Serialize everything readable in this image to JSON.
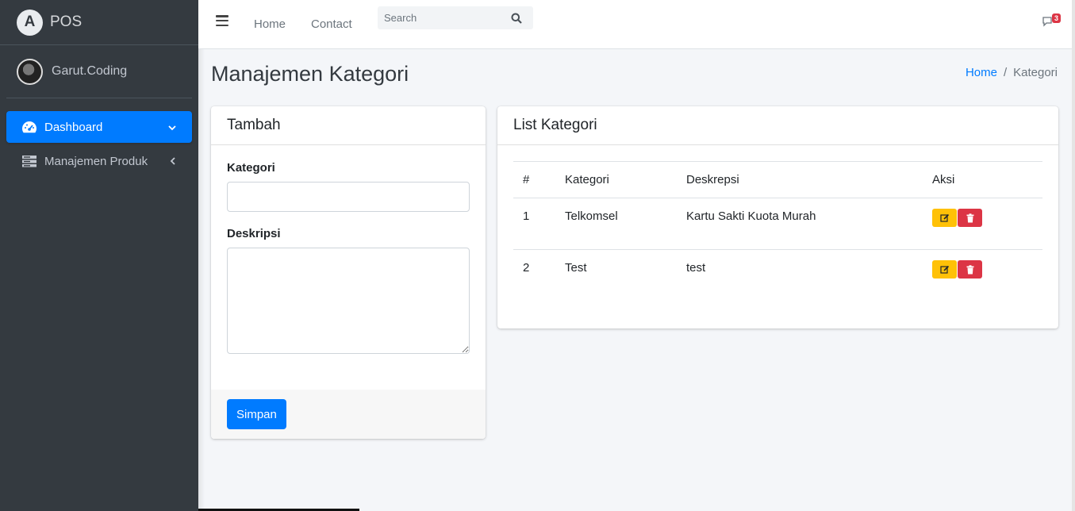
{
  "brand": {
    "name": "POS",
    "logo_letter": "A"
  },
  "user": {
    "name": "Garut.Coding"
  },
  "sidebar": {
    "items": [
      {
        "label": "Dashboard",
        "icon": "gauge-icon",
        "caret": "chevron-down-icon",
        "active": true
      },
      {
        "label": "Manajemen Produk",
        "icon": "server-icon",
        "caret": "chevron-left-icon",
        "active": false
      }
    ]
  },
  "navbar": {
    "links": [
      "Home",
      "Contact"
    ],
    "search_placeholder": "Search",
    "messages_count": "3"
  },
  "page": {
    "title": "Manajemen Kategori",
    "breadcrumb": {
      "home": "Home",
      "separator": "/",
      "current": "Kategori"
    }
  },
  "form_card": {
    "title": "Tambah",
    "kategori_label": "Kategori",
    "kategori_value": "",
    "deskripsi_label": "Deskripsi",
    "deskripsi_value": "",
    "submit_label": "Simpan"
  },
  "list_card": {
    "title": "List Kategori",
    "columns": [
      "#",
      "Kategori",
      "Deskrepsi",
      "Aksi"
    ],
    "rows": [
      {
        "no": "1",
        "kategori": "Telkomsel",
        "deskripsi": "Kartu Sakti Kuota Murah"
      },
      {
        "no": "2",
        "kategori": "Test",
        "deskripsi": "test"
      }
    ]
  },
  "colors": {
    "sidebar_bg": "#343a40",
    "primary": "#007bff",
    "warning": "#ffc107",
    "danger": "#dc3545",
    "content_bg": "#f4f6f9"
  }
}
